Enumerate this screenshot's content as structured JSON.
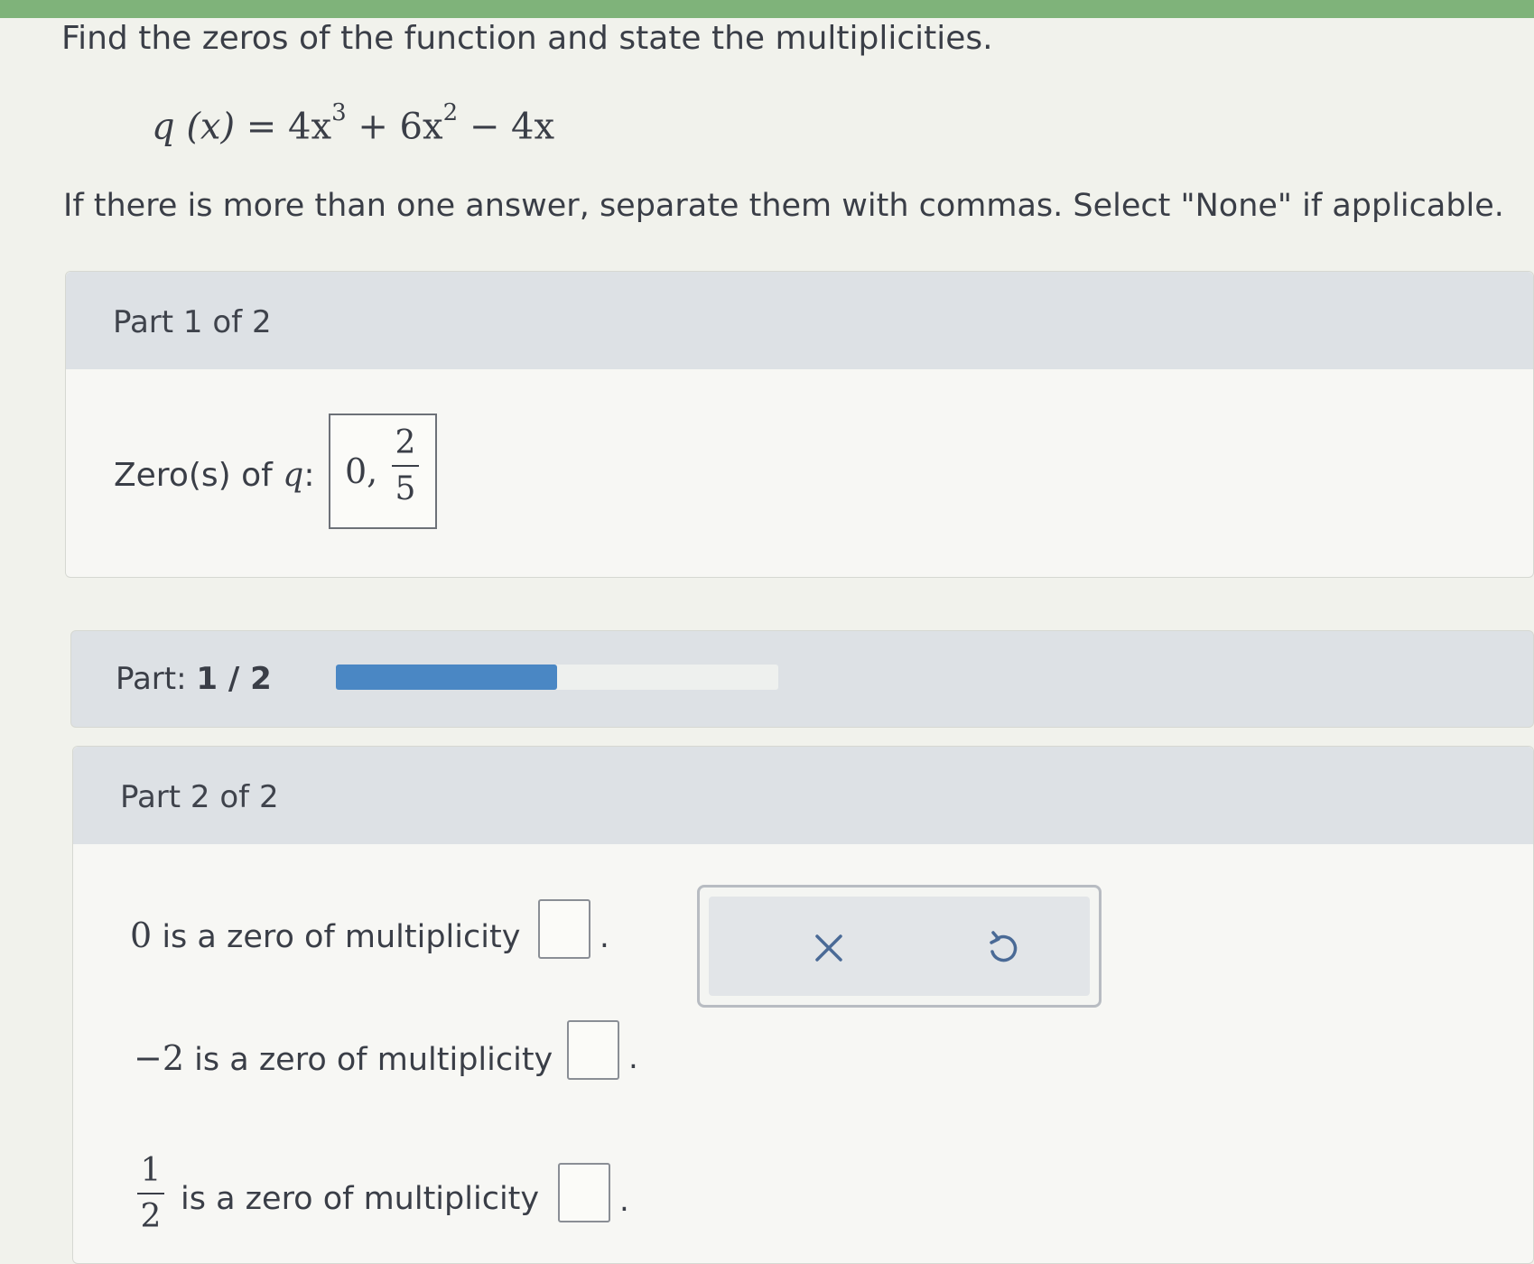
{
  "question": {
    "prompt": "Find the zeros of the function and state the multiplicities.",
    "equation": {
      "lhs": "q (x) = ",
      "t1_coef": "4x",
      "t1_exp": "3",
      "t2_coef": " + 6x",
      "t2_exp": "2",
      "t3": " − 4x"
    },
    "instruction": "If there is more than one answer, separate them with commas. Select \"None\" if applicable."
  },
  "part1": {
    "title": "Part 1 of 2",
    "zeros_label_prefix": "Zero(s) of ",
    "zeros_label_var": "q",
    "zeros_label_suffix": ":",
    "answer_prefix": "0,",
    "answer_frac_num": "2",
    "answer_frac_den": "5"
  },
  "progress": {
    "label_prefix": "Part: ",
    "label_value": "1 / 2",
    "fraction": 0.5,
    "fill_color": "#4a87c4"
  },
  "part2": {
    "title": "Part 2 of 2",
    "rows": [
      {
        "zero": "0",
        "text": " is a zero of multiplicity",
        "value": "",
        "end": "."
      },
      {
        "zero": "−2",
        "text": " is a zero of multiplicity",
        "value": "",
        "end": "."
      },
      {
        "zero_num": "1",
        "zero_den": "2",
        "text": " is a zero of multiplicity",
        "value": "",
        "end": "."
      }
    ]
  },
  "tools": {
    "clear_icon": "close-icon",
    "undo_icon": "undo-icon"
  }
}
